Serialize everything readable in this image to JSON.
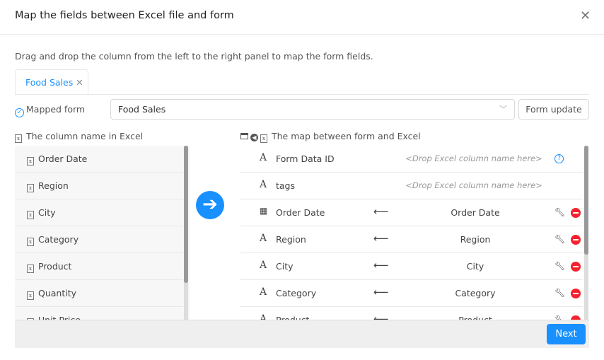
{
  "dialog": {
    "title": "Map the fields between Excel file and form",
    "instruction": "Drag and drop the column from the left to the right panel to map the form fields."
  },
  "tabs": [
    {
      "label": "Food Sales"
    }
  ],
  "mapped_form": {
    "label": "Mapped form",
    "value": "Food Sales",
    "update_button": "Form update"
  },
  "left": {
    "header": "The column name in Excel",
    "items": [
      "Order Date",
      "Region",
      "City",
      "Category",
      "Product",
      "Quantity",
      "Unit Price"
    ]
  },
  "right": {
    "header": "The map between form and Excel",
    "drop_placeholder": "<Drop Excel column name here>",
    "rows": [
      {
        "type": "text",
        "field": "Form Data ID",
        "excel": null
      },
      {
        "type": "text",
        "field": "tags",
        "excel": null
      },
      {
        "type": "date",
        "field": "Order Date",
        "excel": "Order Date"
      },
      {
        "type": "text",
        "field": "Region",
        "excel": "Region"
      },
      {
        "type": "text",
        "field": "City",
        "excel": "City"
      },
      {
        "type": "text",
        "field": "Category",
        "excel": "Category"
      },
      {
        "type": "text",
        "field": "Product",
        "excel": "Product"
      }
    ]
  },
  "footer": {
    "next": "Next"
  },
  "colors": {
    "accent": "#1890ff",
    "remove": "#f5222d"
  }
}
